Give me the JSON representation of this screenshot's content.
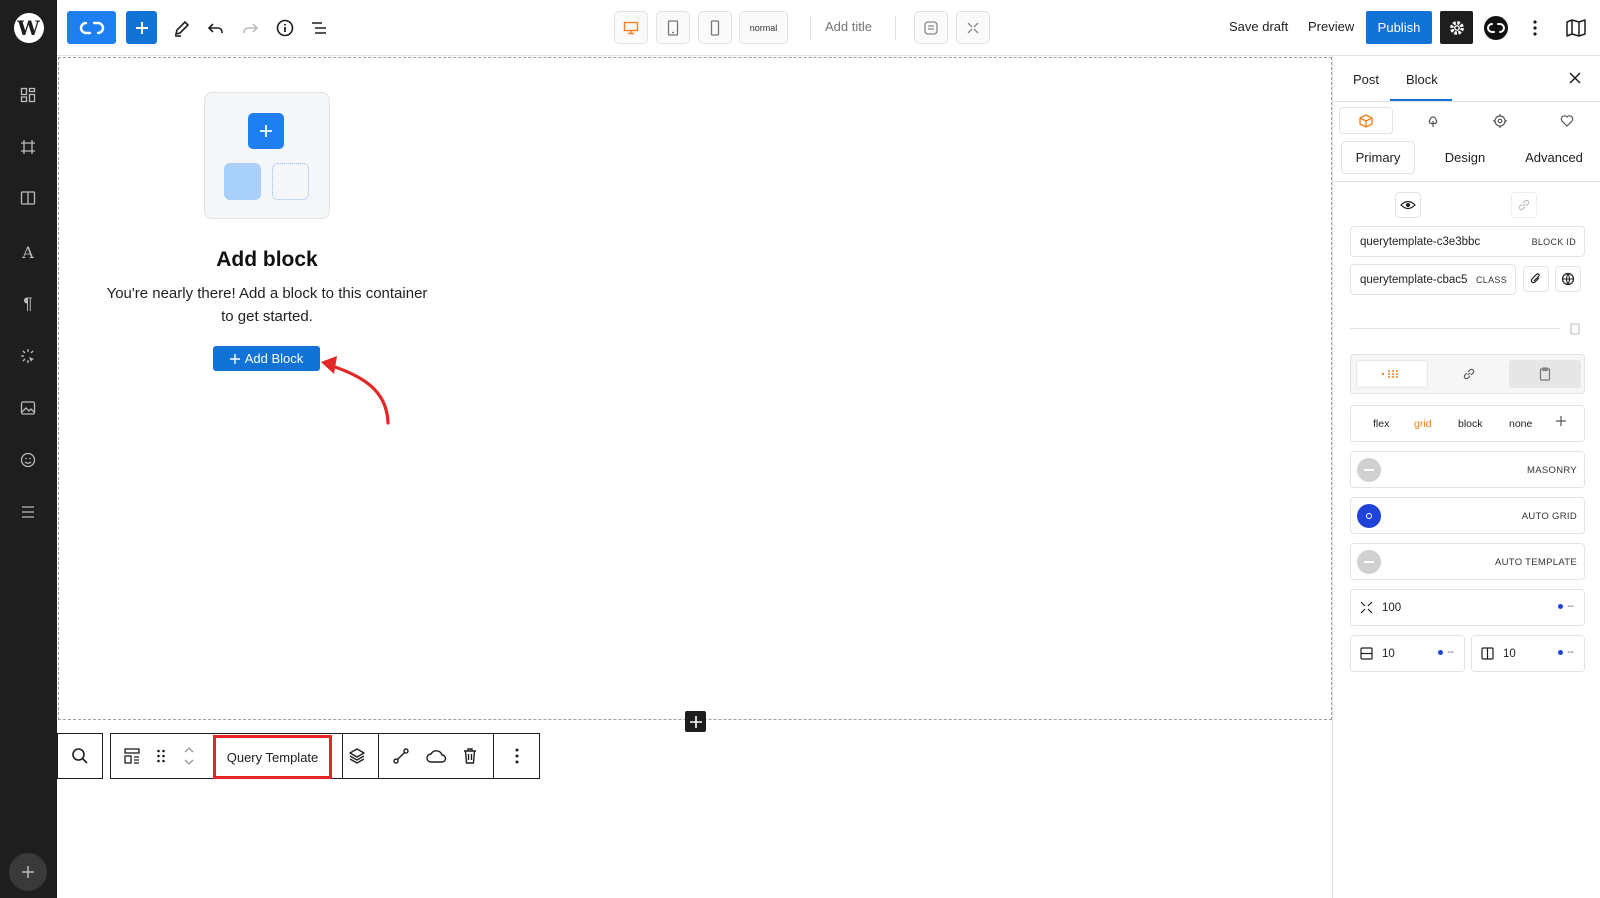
{
  "topbar": {
    "device_mode": "normal",
    "title_placeholder": "Add title",
    "save_draft": "Save draft",
    "preview": "Preview",
    "publish": "Publish"
  },
  "canvas": {
    "placeholder_title": "Add block",
    "placeholder_desc_line1": "You're nearly there! Add a block to this container",
    "placeholder_desc_line2": "to get started.",
    "add_block_button": "Add Block"
  },
  "block_toolbar": {
    "block_name": "Query Template"
  },
  "panel": {
    "tabs": [
      "Post",
      "Block"
    ],
    "sub_tabs": [
      "Primary",
      "Design",
      "Advanced"
    ],
    "block_id_value": "querytemplate-c3e3bbc",
    "block_id_tag": "BLOCK ID",
    "class_value": "querytemplate-cbac5",
    "class_tag": "CLASS",
    "display_options": [
      "flex",
      "grid",
      "block",
      "none"
    ],
    "active_display": "grid",
    "layout_options": [
      "MASONRY",
      "AUTO GRID",
      "AUTO TEMPLATE"
    ],
    "selected_layout": "AUTO GRID",
    "min_width_value": "100",
    "row_gap_value": "10",
    "column_gap_value": "10",
    "unit_placeholder": "--"
  },
  "colors": {
    "accent": "#1273d6",
    "brand_orange": "#f0801e",
    "annotation_red": "#e32626",
    "radio_active": "#1f43d8"
  }
}
